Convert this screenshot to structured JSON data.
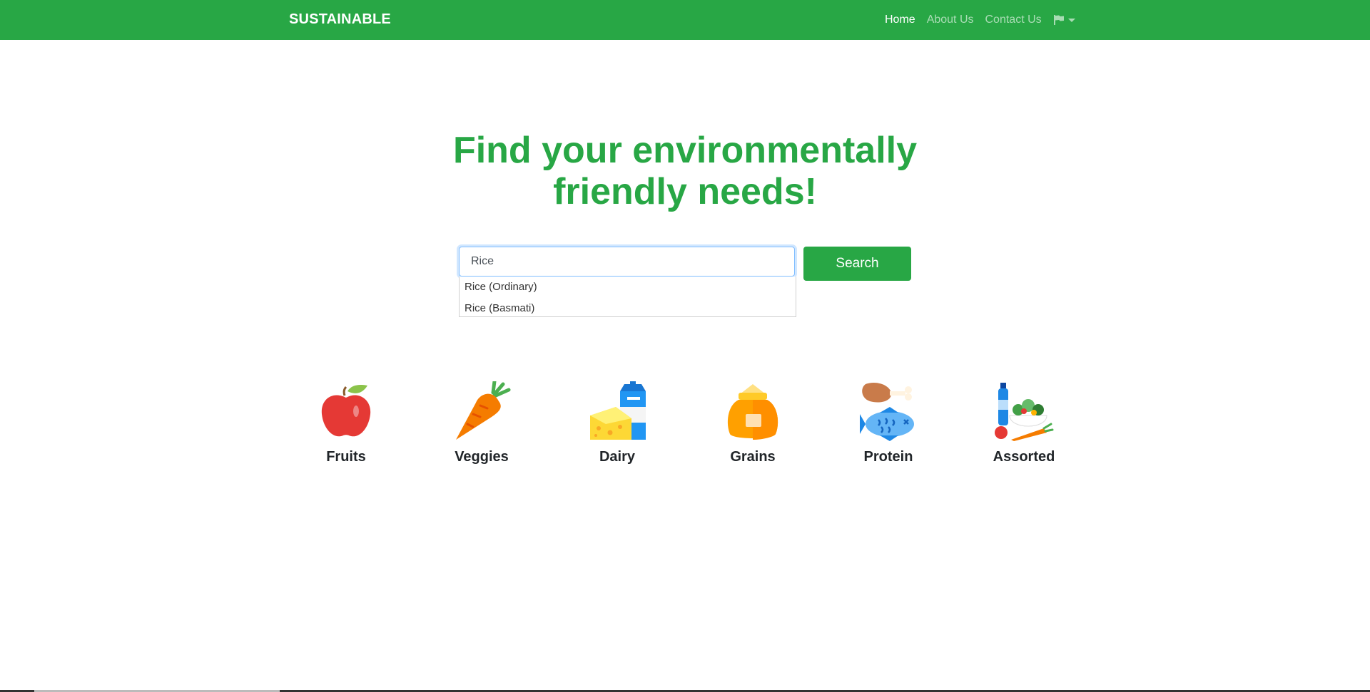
{
  "nav": {
    "brand": "SUSTAINABLE",
    "links": [
      "Home",
      "About Us",
      "Contact Us"
    ],
    "language_icon": "flag-icon"
  },
  "hero": {
    "title": "Find your environmentally friendly needs!"
  },
  "search": {
    "value": "Rice",
    "button_label": "Search",
    "suggestions": [
      "Rice (Ordinary)",
      "Rice (Basmati)"
    ]
  },
  "categories": [
    {
      "label": "Fruits",
      "icon": "apple-icon"
    },
    {
      "label": "Veggies",
      "icon": "carrot-icon"
    },
    {
      "label": "Dairy",
      "icon": "cheese-milk-icon"
    },
    {
      "label": "Grains",
      "icon": "grain-sack-icon"
    },
    {
      "label": "Protein",
      "icon": "chicken-fish-icon"
    },
    {
      "label": "Assorted",
      "icon": "assorted-food-icon"
    }
  ],
  "colors": {
    "brand_green": "#28a745",
    "focus_border": "#80bdff"
  }
}
